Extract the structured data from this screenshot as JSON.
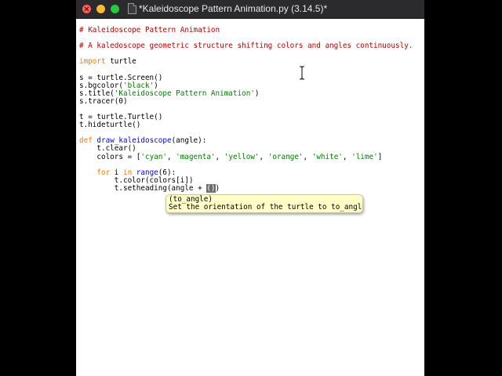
{
  "window": {
    "title": "*Kaleidoscope Pattern Animation.py (3.14.5)*",
    "controls": [
      "close",
      "minimize",
      "zoom"
    ]
  },
  "code": {
    "l01": "# Kaleidoscope Pattern Animation",
    "l02": "# A kaledoscope geometric structure shifting colors and angles continuously.",
    "l03_kw": "import",
    "l03_rest": " turtle",
    "l04a": "s = turtle.Screen()",
    "l05a": "s.bgcolor(",
    "l05s": "'black'",
    "l05b": ")",
    "l06a": "s.title(",
    "l06s": "'Kaleidoscope Pattern Animation'",
    "l06b": ")",
    "l07": "s.tracer(0)",
    "l08": "t = turtle.Turtle()",
    "l09": "t.hideturtle()",
    "l10_kw": "def",
    "l10_sp": " ",
    "l10_fn": "draw_kaleidoscope",
    "l10_rest": "(angle):",
    "l11": "    t.clear()",
    "l12_a": "    colors = [",
    "l12_s1": "'cyan'",
    "l12_s2": "'magenta'",
    "l12_s3": "'yellow'",
    "l12_s4": "'orange'",
    "l12_s5": "'white'",
    "l12_s6": "'lime'",
    "l12_sep": ", ",
    "l12_end": "]",
    "l13_ind": "    ",
    "l13_for": "for",
    "l13_mid": " i ",
    "l13_in": "in",
    "l13_sp": " ",
    "l13_range": "range",
    "l13_end": "(6):",
    "l14": "        t.color(colors[i])",
    "l15_a": "        t.setheading(angle + ",
    "l15_cur": "()",
    "l15_b": ")"
  },
  "calltip": {
    "signature": "(to_angle)",
    "description": "Set the orientation of the turtle to to_angle"
  }
}
